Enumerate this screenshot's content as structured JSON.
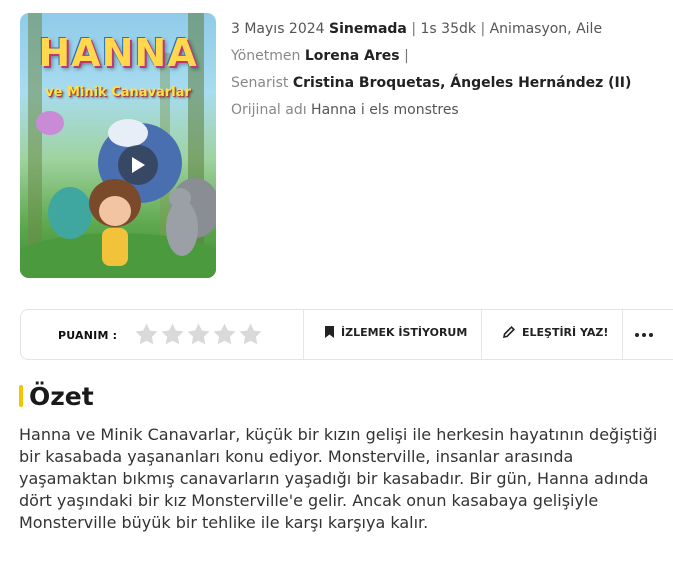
{
  "poster": {
    "title": "HANNA",
    "subtitle": "ve Minik Canavarlar",
    "play_icon": "play-icon"
  },
  "info": {
    "date": "3 Mayıs 2024",
    "status": "Sinemada",
    "duration": "1s 35dk",
    "genres": "Animasyon, Aile",
    "director_label": "Yönetmen",
    "director": "Lorena Ares",
    "writer_label": "Senarist",
    "writers": "Cristina Broquetas, Ángeles Hernández (II)",
    "original_label": "Orijinal adı",
    "original_title": "Hanna i els monstres"
  },
  "actions": {
    "rating_label": "PUANIM :",
    "stars_total": 5,
    "stars_filled": 0,
    "watchlist_label": "İZLEMEK İSTİYORUM",
    "review_label": "ELEŞTİRİ YAZ!",
    "more_icon": "more-dots-icon"
  },
  "summary": {
    "heading": "Özet",
    "text": "Hanna ve Minik Canavarlar, küçük bir kızın gelişi ile herkesin hayatının değiştiği bir kasabada yaşananları konu ediyor. Monsterville, insanlar arasında yaşamaktan bıkmış canavarların yaşadığı bir kasabadır. Bir gün, Hanna adında dört yaşındaki bir kız Monsterville'e gelir. Ancak onun kasabaya gelişiyle Monsterville büyük bir tehlike ile karşı karşıya kalır."
  },
  "colors": {
    "accent": "#f5c400",
    "star_empty": "#d9d9d9"
  }
}
